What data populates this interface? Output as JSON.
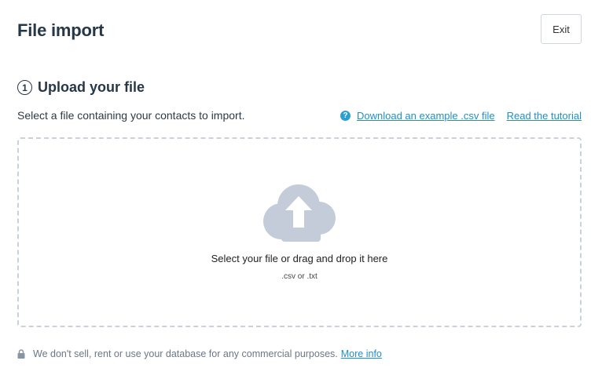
{
  "header": {
    "title": "File import",
    "exit_label": "Exit"
  },
  "step": {
    "number": "1",
    "title": "Upload your file",
    "description": "Select a file containing your contacts to import."
  },
  "help": {
    "help_icon": "question-circle-icon",
    "download_example_label": "Download an example .csv file",
    "tutorial_label": "Read the tutorial"
  },
  "dropzone": {
    "icon": "cloud-upload-icon",
    "instruction": "Select your file or drag and drop it here",
    "formats": ".csv or .txt"
  },
  "privacy": {
    "icon": "lock-icon",
    "text": "We don't sell, rent or use your database for any commercial purposes.",
    "more_info_label": "More info"
  },
  "colors": {
    "link": "#1f8fc8",
    "dropzone_border": "#c8d1dc",
    "cloud": "#c3ccd8",
    "help_icon": "#2a9fd6"
  }
}
